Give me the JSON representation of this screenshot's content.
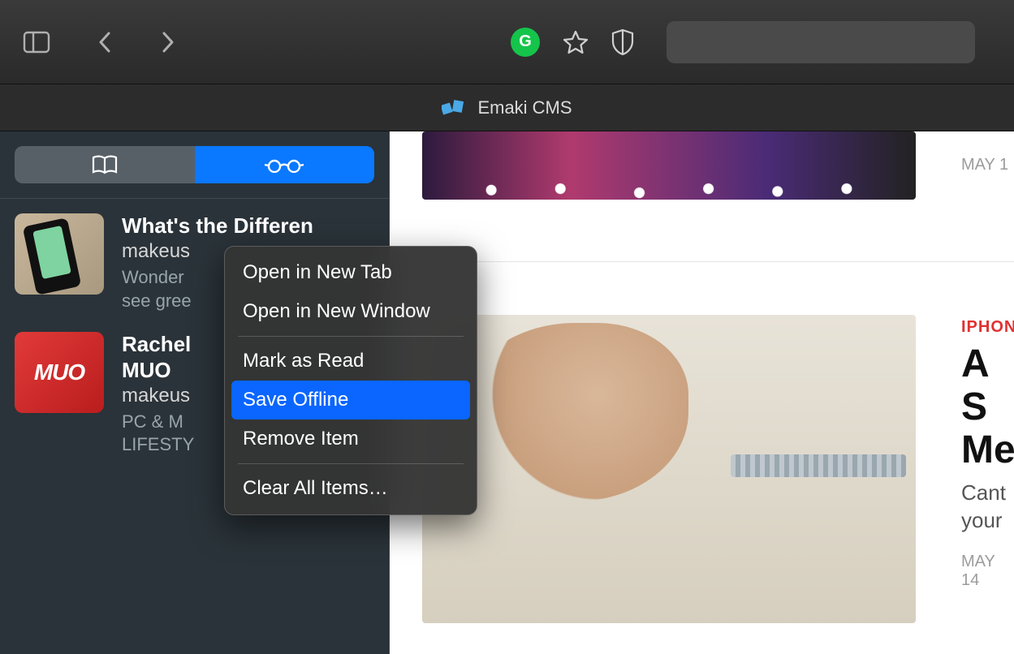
{
  "toolbar": {
    "g_label": "G"
  },
  "tab": {
    "label": "Emaki CMS"
  },
  "sidebar": {
    "items": [
      {
        "title": "What's the Differen",
        "domain": "makeus",
        "excerpt1": "Wonder",
        "excerpt2": "see gree"
      },
      {
        "title": "Rachel",
        "title2": "MUO",
        "domain": "makeus",
        "excerpt1": "PC & M",
        "excerpt2": "LIFESTY"
      }
    ]
  },
  "content": {
    "top_date": "MAY 1",
    "category": "IPHON",
    "headline1": "A S",
    "headline2": "Me",
    "sub1": "Cant",
    "sub2": "your",
    "date": "MAY 14"
  },
  "menu": {
    "open_tab": "Open in New Tab",
    "open_window": "Open in New Window",
    "mark_read": "Mark as Read",
    "save_offline": "Save Offline",
    "remove": "Remove Item",
    "clear_all": "Clear All Items…"
  }
}
